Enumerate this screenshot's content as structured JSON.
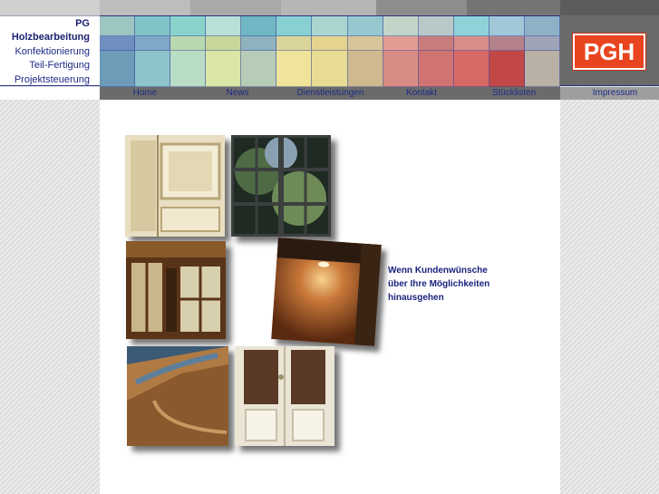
{
  "brand": {
    "lines": [
      "PG",
      "Holzbearbeitung",
      "Konfektionierung",
      "Teil-Fertigung",
      "Projektsteuerung"
    ],
    "logo_text": "PGH"
  },
  "nav": {
    "items": [
      "Home",
      "News",
      "Dienstleistungen",
      "Kontakt",
      "Stücklisten",
      "Impressum"
    ]
  },
  "tagline": {
    "lines": [
      "Wenn Kundenwünsche",
      "über Ihre Möglichkeiten",
      "hinausgehen"
    ]
  },
  "colors": {
    "accent_navy": "#1e2a86",
    "logo_orange": "#e8441f",
    "nav_gray": "#6b6b6b"
  },
  "photos": [
    {
      "name": "carved-door-photo",
      "icon": "ornate-door-panel"
    },
    {
      "name": "window-trees-photo",
      "icon": "window-with-trees"
    },
    {
      "name": "conservatory-photo",
      "icon": "wood-room-interior"
    },
    {
      "name": "lamp-paneling-photo",
      "icon": "wall-lamp-wood"
    },
    {
      "name": "staircase-photo",
      "icon": "wooden-staircase"
    },
    {
      "name": "double-door-photo",
      "icon": "white-double-door"
    }
  ]
}
